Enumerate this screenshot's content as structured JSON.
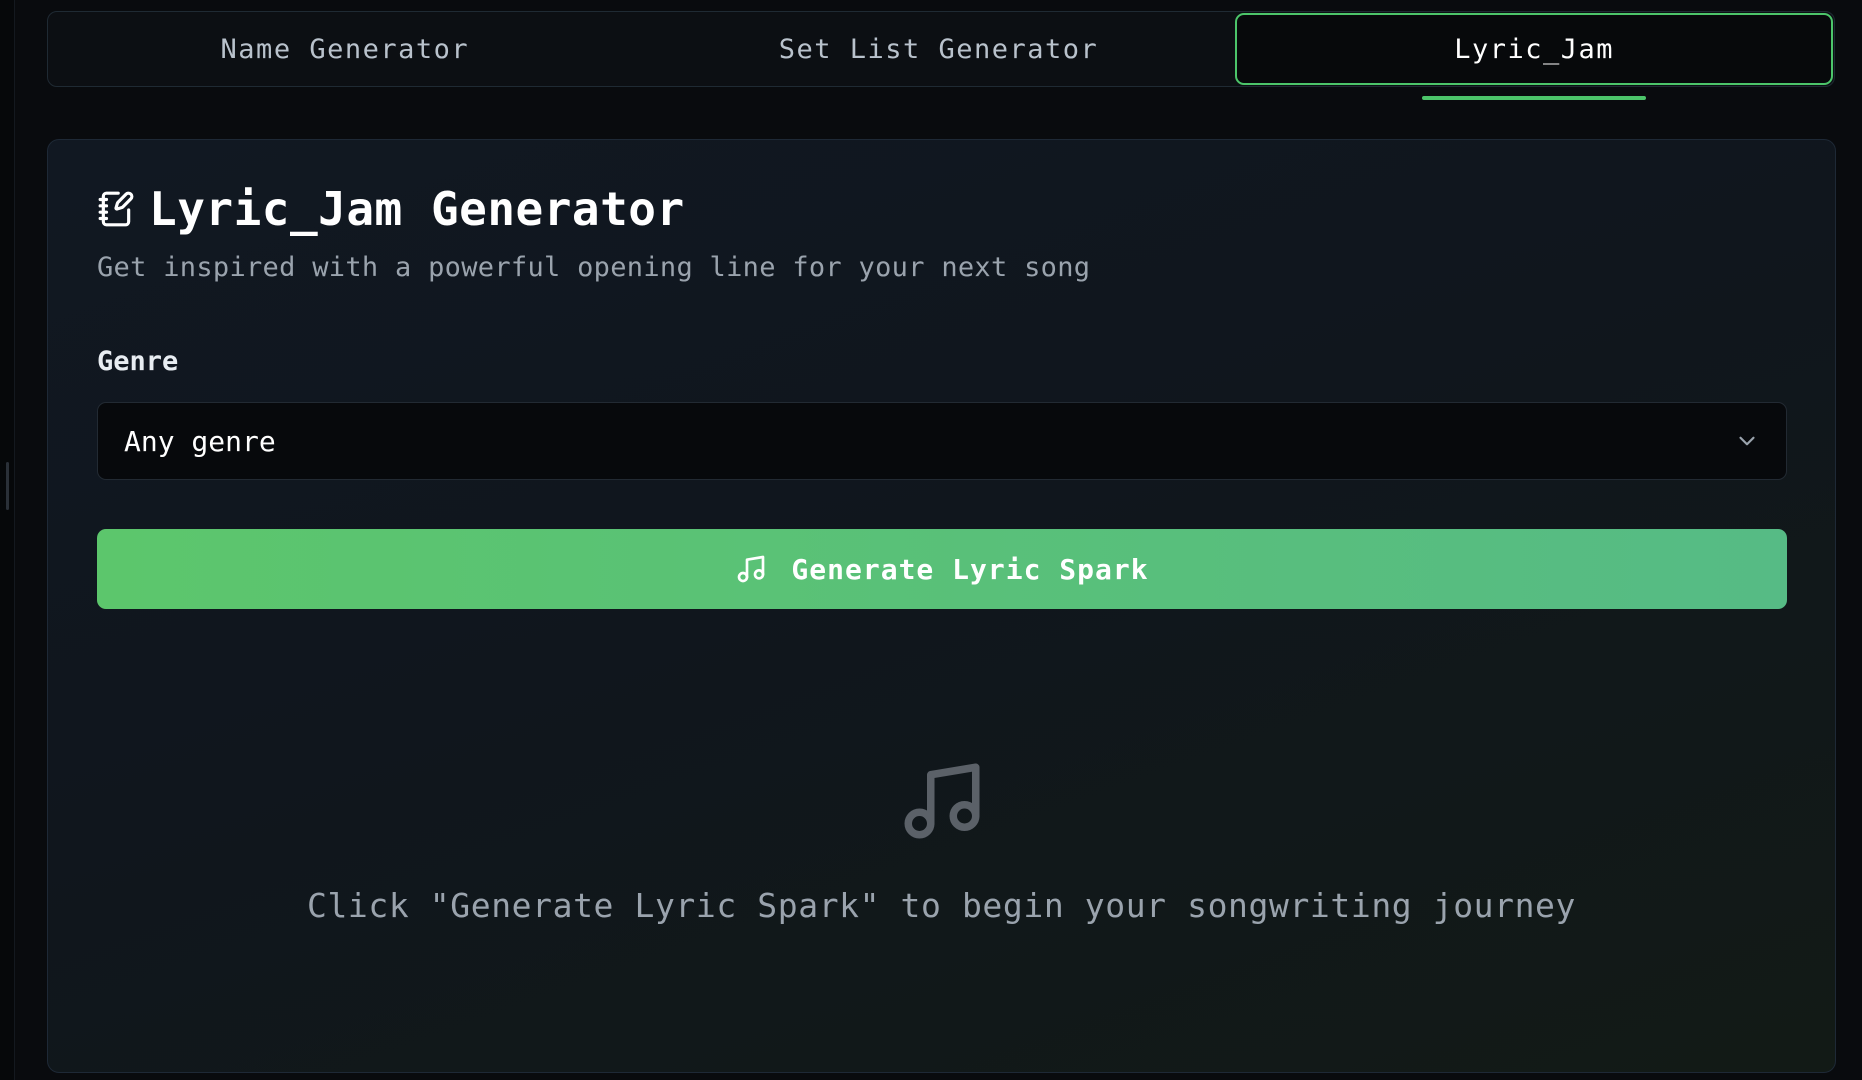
{
  "tabs": [
    {
      "label": "Name Generator",
      "active": false
    },
    {
      "label": "Set List Generator",
      "active": false
    },
    {
      "label": "Lyric_Jam",
      "active": true
    }
  ],
  "card": {
    "title": "Lyric_Jam Generator",
    "title_icon": "notebook-pen-icon",
    "subtitle": "Get inspired with a powerful opening line for your next song",
    "genre_label": "Genre",
    "genre_select": {
      "value": "Any genre",
      "icon": "chevron-down-icon"
    },
    "generate_button": {
      "label": "Generate Lyric Spark",
      "icon": "music-note-icon"
    },
    "empty_state": {
      "icon": "music-note-icon",
      "text": "Click \"Generate Lyric Spark\" to begin your songwriting journey"
    }
  },
  "colors": {
    "accent": "#4cc56a",
    "button_gradient_start": "#5cc66c",
    "button_gradient_end": "#56bb85",
    "background": "#090b0e"
  }
}
